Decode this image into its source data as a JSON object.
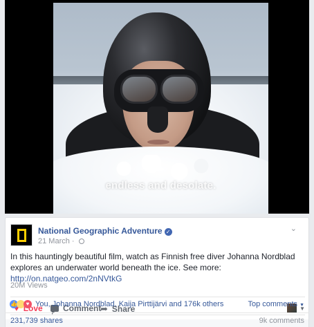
{
  "video": {
    "subtitle": "endless and desolate."
  },
  "post": {
    "page_name": "National Geographic Adventure",
    "date": "21 March",
    "body": "In this hauntingly beautiful film, watch as Finnish free diver Johanna Nordblad explores an underwater world beneath the ice. See more: ",
    "link": "http://on.natgeo.com/2nNVtkG",
    "views": "20M Views"
  },
  "actions": {
    "love": "Love",
    "comment": "Comment",
    "share": "Share"
  },
  "reactions": {
    "summary": "You, Johanna Nordblad, Kaija Pirttijärvi and 176k others",
    "top_comments": "Top comments",
    "shares": "231,739 shares",
    "comments": "9k comments"
  },
  "colors": {
    "link": "#365899",
    "love": "#f33e58",
    "natgeo_yellow": "#ffce00"
  }
}
